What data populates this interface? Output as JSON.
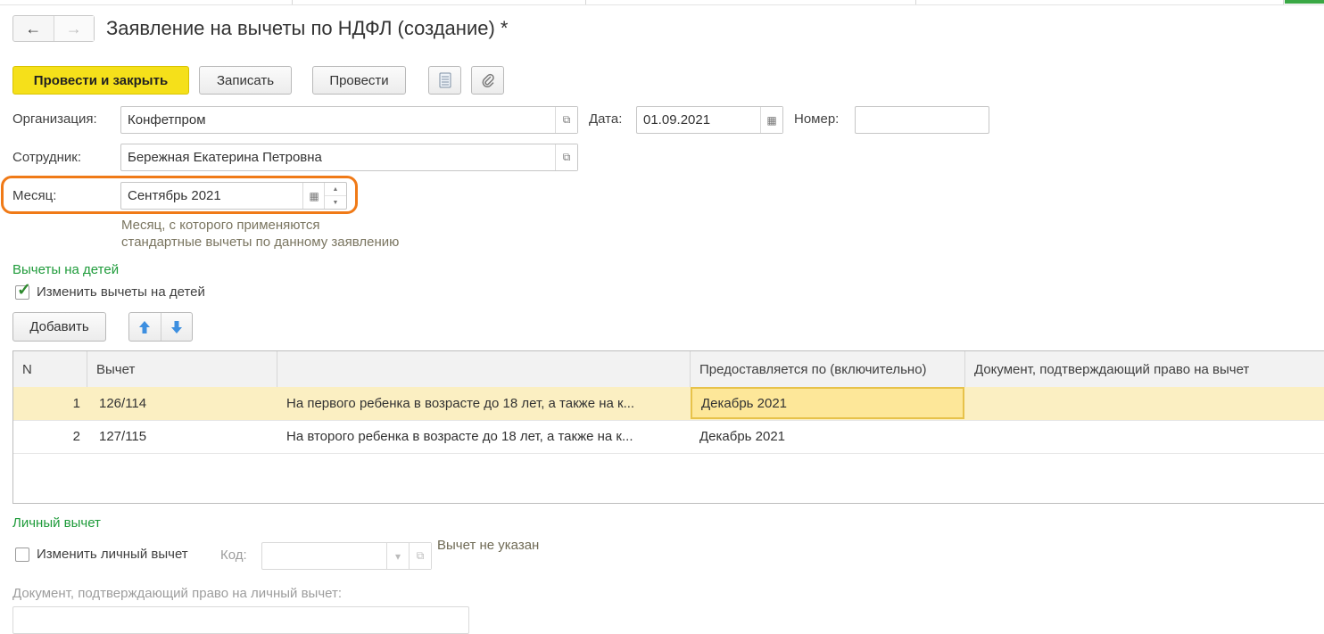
{
  "window": {
    "title": "Заявление на вычеты по НДФЛ (создание) *",
    "nav": {
      "back": "←",
      "forward": "→"
    }
  },
  "toolbar": {
    "post_close": "Провести и закрыть",
    "save": "Записать",
    "post": "Провести",
    "report_icon": "document-list-icon",
    "attach_icon": "paperclip-icon"
  },
  "form": {
    "org_label": "Организация:",
    "org_value": "Конфетпром",
    "date_label": "Дата:",
    "date_value": "01.09.2021",
    "number_label": "Номер:",
    "number_value": "",
    "employee_label": "Сотрудник:",
    "employee_value": "Бережная Екатерина Петровна",
    "month_label": "Месяц:",
    "month_value": "Сентябрь 2021",
    "month_hint_1": "Месяц, с которого применяются",
    "month_hint_2": "стандартные вычеты по данному заявлению"
  },
  "children": {
    "section_title": "Вычеты на детей",
    "change_checkbox_label": "Изменить вычеты на детей",
    "change_checked": true,
    "add_button": "Добавить",
    "columns": [
      "N",
      "Вычет",
      "",
      "Предоставляется по (включительно)",
      "Документ, подтверждающий право на вычет"
    ],
    "rows": [
      {
        "n": "1",
        "code": "126/114",
        "desc": "На первого ребенка в возрасте до 18 лет, а также на к...",
        "until": "Декабрь 2021",
        "doc": ""
      },
      {
        "n": "2",
        "code": "127/115",
        "desc": "На второго ребенка в возрасте до 18 лет, а также на к...",
        "until": "Декабрь 2021",
        "doc": ""
      }
    ]
  },
  "personal": {
    "section_title": "Личный вычет",
    "change_checkbox_label": "Изменить личный вычет",
    "code_label": "Код:",
    "code_value": "",
    "status_text": "Вычет не указан",
    "doc_label": "Документ, подтверждающий право на личный вычет:"
  },
  "colors": {
    "primary": "#f5e01a",
    "section": "#1e9b3a",
    "highlight": "#f07a17",
    "selected_row": "#fbefc2"
  }
}
